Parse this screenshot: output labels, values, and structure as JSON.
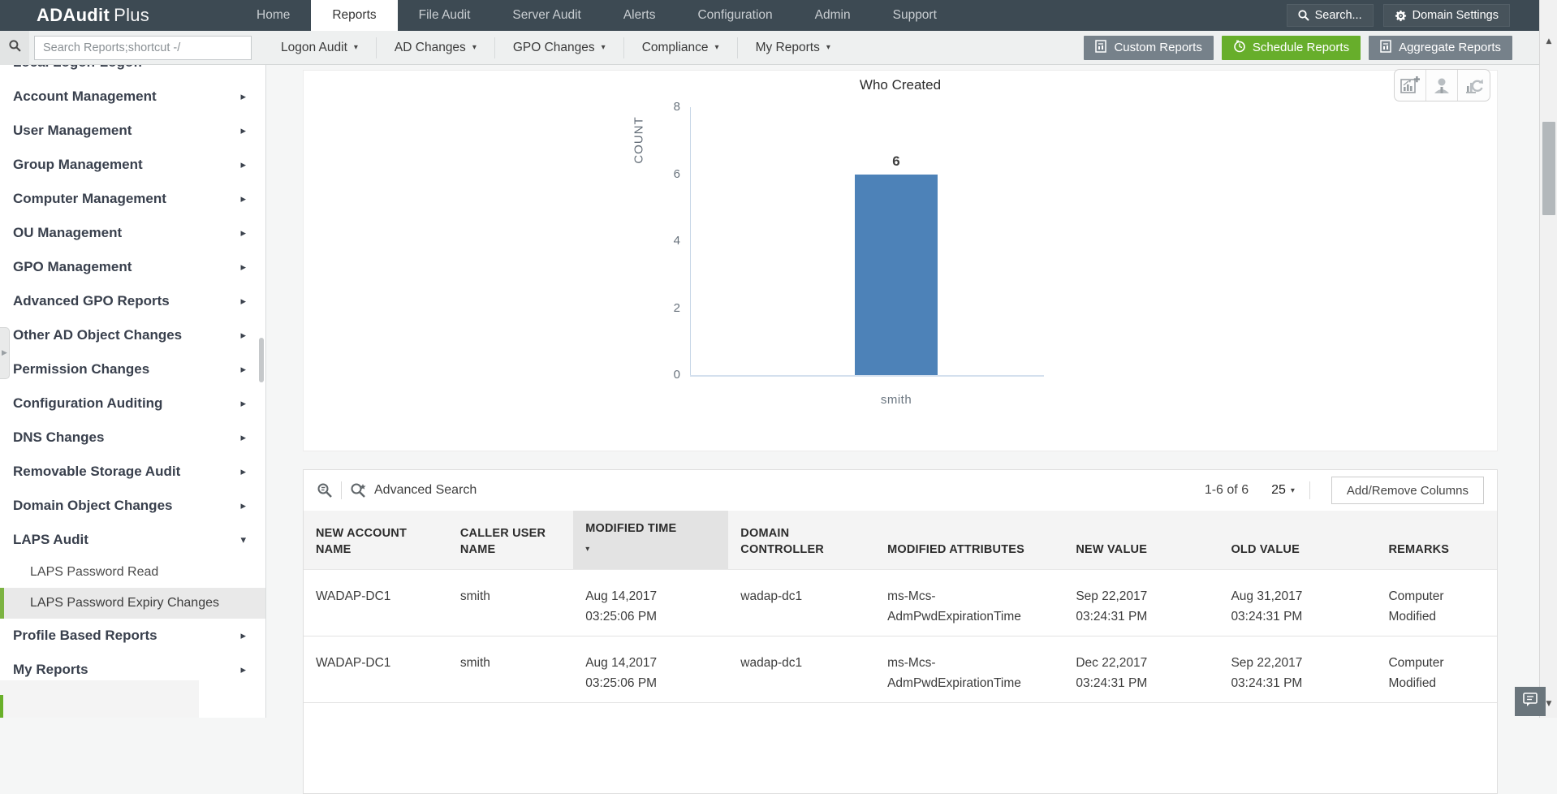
{
  "nav": {
    "brand_bold": "ADAudit",
    "brand_light": "Plus",
    "items": [
      {
        "label": "Home",
        "active": false
      },
      {
        "label": "Reports",
        "active": true
      },
      {
        "label": "File Audit",
        "active": false
      },
      {
        "label": "Server Audit",
        "active": false
      },
      {
        "label": "Alerts",
        "active": false
      },
      {
        "label": "Configuration",
        "active": false
      },
      {
        "label": "Admin",
        "active": false
      },
      {
        "label": "Support",
        "active": false
      }
    ],
    "search_label": "Search...",
    "domain_settings_label": "Domain Settings"
  },
  "toolbar": {
    "search_placeholder": "Search Reports;shortcut -/",
    "menus": [
      "Logon Audit",
      "AD Changes",
      "GPO Changes",
      "Compliance",
      "My Reports"
    ],
    "buttons": [
      {
        "label": "Custom Reports",
        "style": "gray",
        "icon": "report-icon"
      },
      {
        "label": "Schedule Reports",
        "style": "green",
        "icon": "clock-icon"
      },
      {
        "label": "Aggregate Reports",
        "style": "gray",
        "icon": "report-icon"
      }
    ]
  },
  "sidebar": {
    "items": [
      {
        "label": "Local Logon-Logoff",
        "type": "main",
        "clipped": true
      },
      {
        "label": "Account Management",
        "type": "main"
      },
      {
        "label": "User Management",
        "type": "main"
      },
      {
        "label": "Group Management",
        "type": "main"
      },
      {
        "label": "Computer Management",
        "type": "main"
      },
      {
        "label": "OU Management",
        "type": "main"
      },
      {
        "label": "GPO Management",
        "type": "main"
      },
      {
        "label": "Advanced GPO Reports",
        "type": "main"
      },
      {
        "label": "Other AD Object Changes",
        "type": "main"
      },
      {
        "label": "Permission Changes",
        "type": "main"
      },
      {
        "label": "Configuration Auditing",
        "type": "main"
      },
      {
        "label": "DNS Changes",
        "type": "main"
      },
      {
        "label": "Removable Storage Audit",
        "type": "main"
      },
      {
        "label": "Domain Object Changes",
        "type": "main"
      },
      {
        "label": "LAPS Audit",
        "type": "main",
        "expanded": true
      },
      {
        "label": "LAPS Password Read",
        "type": "sub"
      },
      {
        "label": "LAPS Password Expiry Changes",
        "type": "sub",
        "selected": true
      },
      {
        "label": "Profile Based Reports",
        "type": "main"
      },
      {
        "label": "My Reports",
        "type": "main"
      }
    ]
  },
  "chart_data": {
    "type": "bar",
    "title": "Who Created",
    "categories": [
      "smith"
    ],
    "values": [
      6
    ],
    "xlabel": "",
    "ylabel": "COUNT",
    "ylim": [
      0,
      8
    ],
    "yticks": [
      0,
      2,
      4,
      6,
      8
    ],
    "bar_color": "#4d82b8",
    "grid": false,
    "value_labels": [
      "6"
    ],
    "tools": [
      "add-chart-icon",
      "user-attribution-icon",
      "refresh-chart-icon"
    ]
  },
  "table": {
    "advanced_search_label": "Advanced Search",
    "pagination": {
      "range": "1-6 of 6",
      "page_size": "25"
    },
    "add_remove_label": "Add/Remove Columns",
    "columns": [
      {
        "lines": [
          "NEW ACCOUNT",
          "NAME"
        ],
        "sorted": false
      },
      {
        "lines": [
          "CALLER USER",
          "NAME"
        ],
        "sorted": false
      },
      {
        "lines": [
          "MODIFIED TIME"
        ],
        "sorted": true
      },
      {
        "lines": [
          "DOMAIN",
          "CONTROLLER"
        ],
        "sorted": false
      },
      {
        "lines": [
          "MODIFIED ATTRIBUTES"
        ],
        "sorted": false
      },
      {
        "lines": [
          "NEW VALUE"
        ],
        "sorted": false
      },
      {
        "lines": [
          "OLD VALUE"
        ],
        "sorted": false
      },
      {
        "lines": [
          "REMARKS"
        ],
        "sorted": false
      }
    ],
    "rows": [
      {
        "cells": [
          [
            "WADAP-DC1"
          ],
          [
            "smith"
          ],
          [
            "Aug 14,2017",
            "03:25:06 PM"
          ],
          [
            "wadap-dc1"
          ],
          [
            "ms-Mcs-",
            "AdmPwdExpirationTime"
          ],
          [
            "Sep 22,2017",
            "03:24:31 PM"
          ],
          [
            "Aug 31,2017",
            "03:24:31 PM"
          ],
          [
            "Computer",
            "Modified"
          ]
        ]
      },
      {
        "cells": [
          [
            "WADAP-DC1"
          ],
          [
            "smith"
          ],
          [
            "Aug 14,2017",
            "03:25:06 PM"
          ],
          [
            "wadap-dc1"
          ],
          [
            "ms-Mcs-",
            "AdmPwdExpirationTime"
          ],
          [
            "Dec 22,2017",
            "03:24:31 PM"
          ],
          [
            "Sep 22,2017",
            "03:24:31 PM"
          ],
          [
            "Computer",
            "Modified"
          ]
        ]
      }
    ]
  }
}
